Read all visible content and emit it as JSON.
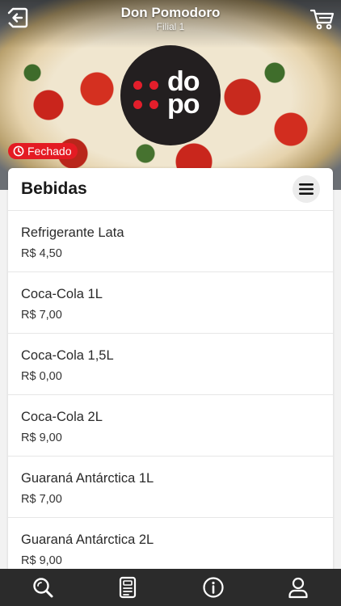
{
  "header": {
    "title": "Don Pomodoro",
    "subtitle": "Filial 1",
    "back_icon": "back-arrow-icon",
    "cart_icon": "cart-icon"
  },
  "logo": {
    "top_text": "do",
    "bottom_text": "po",
    "dot_color": "#e31e2b",
    "bg_color": "#231f20"
  },
  "status": {
    "label": "Fechado",
    "icon": "clock-icon",
    "color": "#e41b23"
  },
  "section": {
    "title": "Bebidas",
    "menu_icon": "hamburger-menu-icon"
  },
  "items": [
    {
      "name": "Refrigerante Lata",
      "price": "R$ 4,50"
    },
    {
      "name": "Coca-Cola 1L",
      "price": "R$ 7,00"
    },
    {
      "name": "Coca-Cola 1,5L",
      "price": "R$ 0,00"
    },
    {
      "name": "Coca-Cola 2L",
      "price": "R$ 9,00"
    },
    {
      "name": "Guaraná Antárctica 1L",
      "price": "R$ 7,00"
    },
    {
      "name": "Guaraná Antárctica 2L",
      "price": "R$ 9,00"
    }
  ],
  "bottom_nav": [
    "search-icon",
    "order-list-icon",
    "info-icon",
    "user-icon"
  ]
}
